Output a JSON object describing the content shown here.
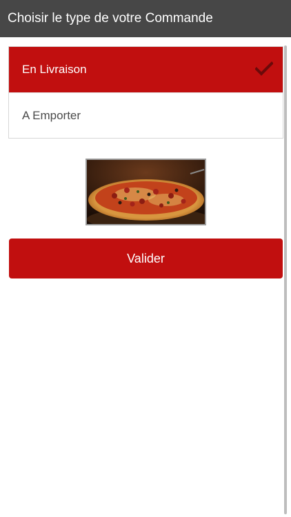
{
  "title_bar": {
    "title": "Choisir le type de votre Commande"
  },
  "order_options": [
    {
      "label": "En Livraison",
      "selected": true
    },
    {
      "label": "A Emporter",
      "selected": false
    }
  ],
  "icons": {
    "selected_indicator": "checkmark-icon",
    "hero_image": "pizza-image"
  },
  "valider_button": {
    "label": "Valider"
  },
  "colors": {
    "title_bar": "#474747",
    "accent_red": "#c10f0f",
    "checkmark": "#7a0b0b"
  }
}
